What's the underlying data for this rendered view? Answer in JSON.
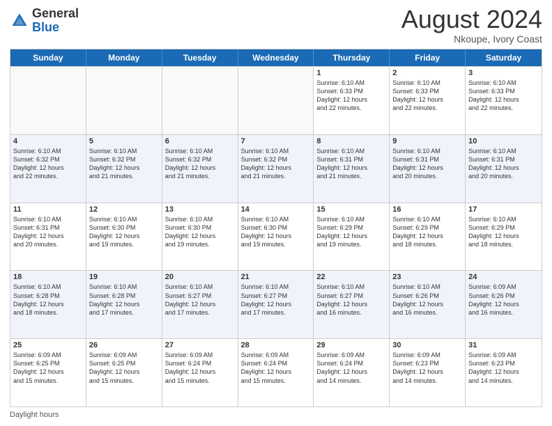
{
  "logo": {
    "general": "General",
    "blue": "Blue"
  },
  "header": {
    "month_year": "August 2024",
    "location": "Nkoupe, Ivory Coast"
  },
  "days_of_week": [
    "Sunday",
    "Monday",
    "Tuesday",
    "Wednesday",
    "Thursday",
    "Friday",
    "Saturday"
  ],
  "footer_label": "Daylight hours",
  "weeks": [
    [
      {
        "day": "",
        "info": ""
      },
      {
        "day": "",
        "info": ""
      },
      {
        "day": "",
        "info": ""
      },
      {
        "day": "",
        "info": ""
      },
      {
        "day": "1",
        "info": "Sunrise: 6:10 AM\nSunset: 6:33 PM\nDaylight: 12 hours\nand 22 minutes."
      },
      {
        "day": "2",
        "info": "Sunrise: 6:10 AM\nSunset: 6:33 PM\nDaylight: 12 hours\nand 22 minutes."
      },
      {
        "day": "3",
        "info": "Sunrise: 6:10 AM\nSunset: 6:33 PM\nDaylight: 12 hours\nand 22 minutes."
      }
    ],
    [
      {
        "day": "4",
        "info": "Sunrise: 6:10 AM\nSunset: 6:32 PM\nDaylight: 12 hours\nand 22 minutes."
      },
      {
        "day": "5",
        "info": "Sunrise: 6:10 AM\nSunset: 6:32 PM\nDaylight: 12 hours\nand 21 minutes."
      },
      {
        "day": "6",
        "info": "Sunrise: 6:10 AM\nSunset: 6:32 PM\nDaylight: 12 hours\nand 21 minutes."
      },
      {
        "day": "7",
        "info": "Sunrise: 6:10 AM\nSunset: 6:32 PM\nDaylight: 12 hours\nand 21 minutes."
      },
      {
        "day": "8",
        "info": "Sunrise: 6:10 AM\nSunset: 6:31 PM\nDaylight: 12 hours\nand 21 minutes."
      },
      {
        "day": "9",
        "info": "Sunrise: 6:10 AM\nSunset: 6:31 PM\nDaylight: 12 hours\nand 20 minutes."
      },
      {
        "day": "10",
        "info": "Sunrise: 6:10 AM\nSunset: 6:31 PM\nDaylight: 12 hours\nand 20 minutes."
      }
    ],
    [
      {
        "day": "11",
        "info": "Sunrise: 6:10 AM\nSunset: 6:31 PM\nDaylight: 12 hours\nand 20 minutes."
      },
      {
        "day": "12",
        "info": "Sunrise: 6:10 AM\nSunset: 6:30 PM\nDaylight: 12 hours\nand 19 minutes."
      },
      {
        "day": "13",
        "info": "Sunrise: 6:10 AM\nSunset: 6:30 PM\nDaylight: 12 hours\nand 19 minutes."
      },
      {
        "day": "14",
        "info": "Sunrise: 6:10 AM\nSunset: 6:30 PM\nDaylight: 12 hours\nand 19 minutes."
      },
      {
        "day": "15",
        "info": "Sunrise: 6:10 AM\nSunset: 6:29 PM\nDaylight: 12 hours\nand 19 minutes."
      },
      {
        "day": "16",
        "info": "Sunrise: 6:10 AM\nSunset: 6:29 PM\nDaylight: 12 hours\nand 18 minutes."
      },
      {
        "day": "17",
        "info": "Sunrise: 6:10 AM\nSunset: 6:29 PM\nDaylight: 12 hours\nand 18 minutes."
      }
    ],
    [
      {
        "day": "18",
        "info": "Sunrise: 6:10 AM\nSunset: 6:28 PM\nDaylight: 12 hours\nand 18 minutes."
      },
      {
        "day": "19",
        "info": "Sunrise: 6:10 AM\nSunset: 6:28 PM\nDaylight: 12 hours\nand 17 minutes."
      },
      {
        "day": "20",
        "info": "Sunrise: 6:10 AM\nSunset: 6:27 PM\nDaylight: 12 hours\nand 17 minutes."
      },
      {
        "day": "21",
        "info": "Sunrise: 6:10 AM\nSunset: 6:27 PM\nDaylight: 12 hours\nand 17 minutes."
      },
      {
        "day": "22",
        "info": "Sunrise: 6:10 AM\nSunset: 6:27 PM\nDaylight: 12 hours\nand 16 minutes."
      },
      {
        "day": "23",
        "info": "Sunrise: 6:10 AM\nSunset: 6:26 PM\nDaylight: 12 hours\nand 16 minutes."
      },
      {
        "day": "24",
        "info": "Sunrise: 6:09 AM\nSunset: 6:26 PM\nDaylight: 12 hours\nand 16 minutes."
      }
    ],
    [
      {
        "day": "25",
        "info": "Sunrise: 6:09 AM\nSunset: 6:25 PM\nDaylight: 12 hours\nand 15 minutes."
      },
      {
        "day": "26",
        "info": "Sunrise: 6:09 AM\nSunset: 6:25 PM\nDaylight: 12 hours\nand 15 minutes."
      },
      {
        "day": "27",
        "info": "Sunrise: 6:09 AM\nSunset: 6:24 PM\nDaylight: 12 hours\nand 15 minutes."
      },
      {
        "day": "28",
        "info": "Sunrise: 6:09 AM\nSunset: 6:24 PM\nDaylight: 12 hours\nand 15 minutes."
      },
      {
        "day": "29",
        "info": "Sunrise: 6:09 AM\nSunset: 6:24 PM\nDaylight: 12 hours\nand 14 minutes."
      },
      {
        "day": "30",
        "info": "Sunrise: 6:09 AM\nSunset: 6:23 PM\nDaylight: 12 hours\nand 14 minutes."
      },
      {
        "day": "31",
        "info": "Sunrise: 6:09 AM\nSunset: 6:23 PM\nDaylight: 12 hours\nand 14 minutes."
      }
    ]
  ]
}
